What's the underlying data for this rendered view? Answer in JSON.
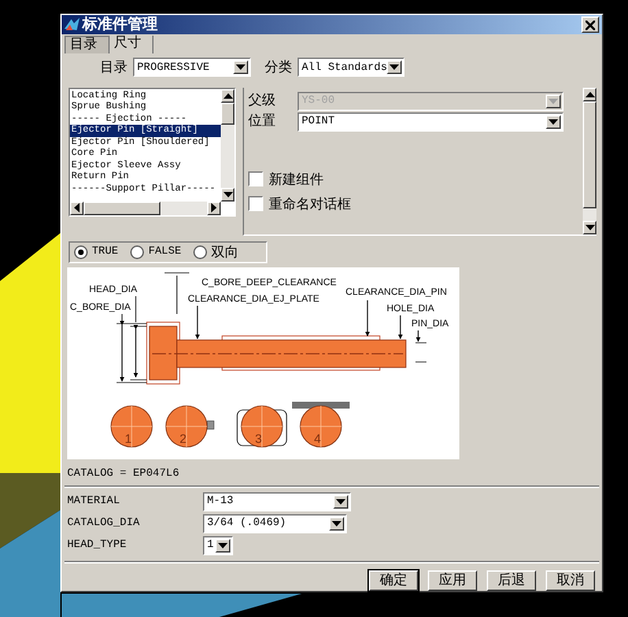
{
  "window": {
    "title": "标准件管理"
  },
  "tabs": [
    {
      "label": "目录",
      "selected": true
    },
    {
      "label": "尺寸",
      "selected": false
    }
  ],
  "filters": [
    {
      "label": "目录",
      "value": "PROGRESSIVE"
    },
    {
      "label": "分类",
      "value": "All Standards"
    }
  ],
  "component_list": {
    "items": [
      {
        "label": "Locating  Ring",
        "selected": false
      },
      {
        "label": "Sprue Bushing",
        "selected": false
      },
      {
        "label": "----- Ejection -----",
        "selected": false
      },
      {
        "label": "Ejector Pin [Straight]",
        "selected": true
      },
      {
        "label": "Ejector Pin [Shouldered]",
        "selected": false
      },
      {
        "label": "Core Pin",
        "selected": false
      },
      {
        "label": "Ejector Sleeve Assy",
        "selected": false
      },
      {
        "label": "Return Pin",
        "selected": false
      },
      {
        "label": "------Support Pillar-----",
        "selected": false
      }
    ]
  },
  "fields": [
    {
      "label": "父级",
      "value": "YS-00",
      "disabled": true
    },
    {
      "label": "位置",
      "value": "POINT",
      "disabled": false
    }
  ],
  "options": [
    {
      "label": "新建组件",
      "checked": false
    },
    {
      "label": "重命名对话框",
      "checked": false
    }
  ],
  "direction": [
    {
      "label": "TRUE",
      "selected": true
    },
    {
      "label": "FALSE",
      "selected": false
    },
    {
      "label": "双向",
      "selected": false
    }
  ],
  "diagram": {
    "labels": [
      "HEAD_DIA",
      "C_BORE_DIA",
      "C_BORE_DEEP_CLEARANCE",
      "CLEARANCE_DIA_EJ_PLATE",
      "CLEARANCE_DIA_PIN",
      "HOLE_DIA",
      "PIN_DIA"
    ],
    "head_types": [
      "1",
      "2",
      "3",
      "4"
    ]
  },
  "catalog": "CATALOG = EP047L6",
  "parameters": [
    {
      "label": "MATERIAL",
      "value": "M-13"
    },
    {
      "label": "CATALOG_DIA",
      "value": "3/64 (.0469)"
    },
    {
      "label": "HEAD_TYPE",
      "value": "1"
    }
  ],
  "buttons": [
    {
      "label": "确定",
      "default": true
    },
    {
      "label": "应用",
      "default": false
    },
    {
      "label": "后退",
      "default": false
    },
    {
      "label": "取消",
      "default": false
    }
  ]
}
